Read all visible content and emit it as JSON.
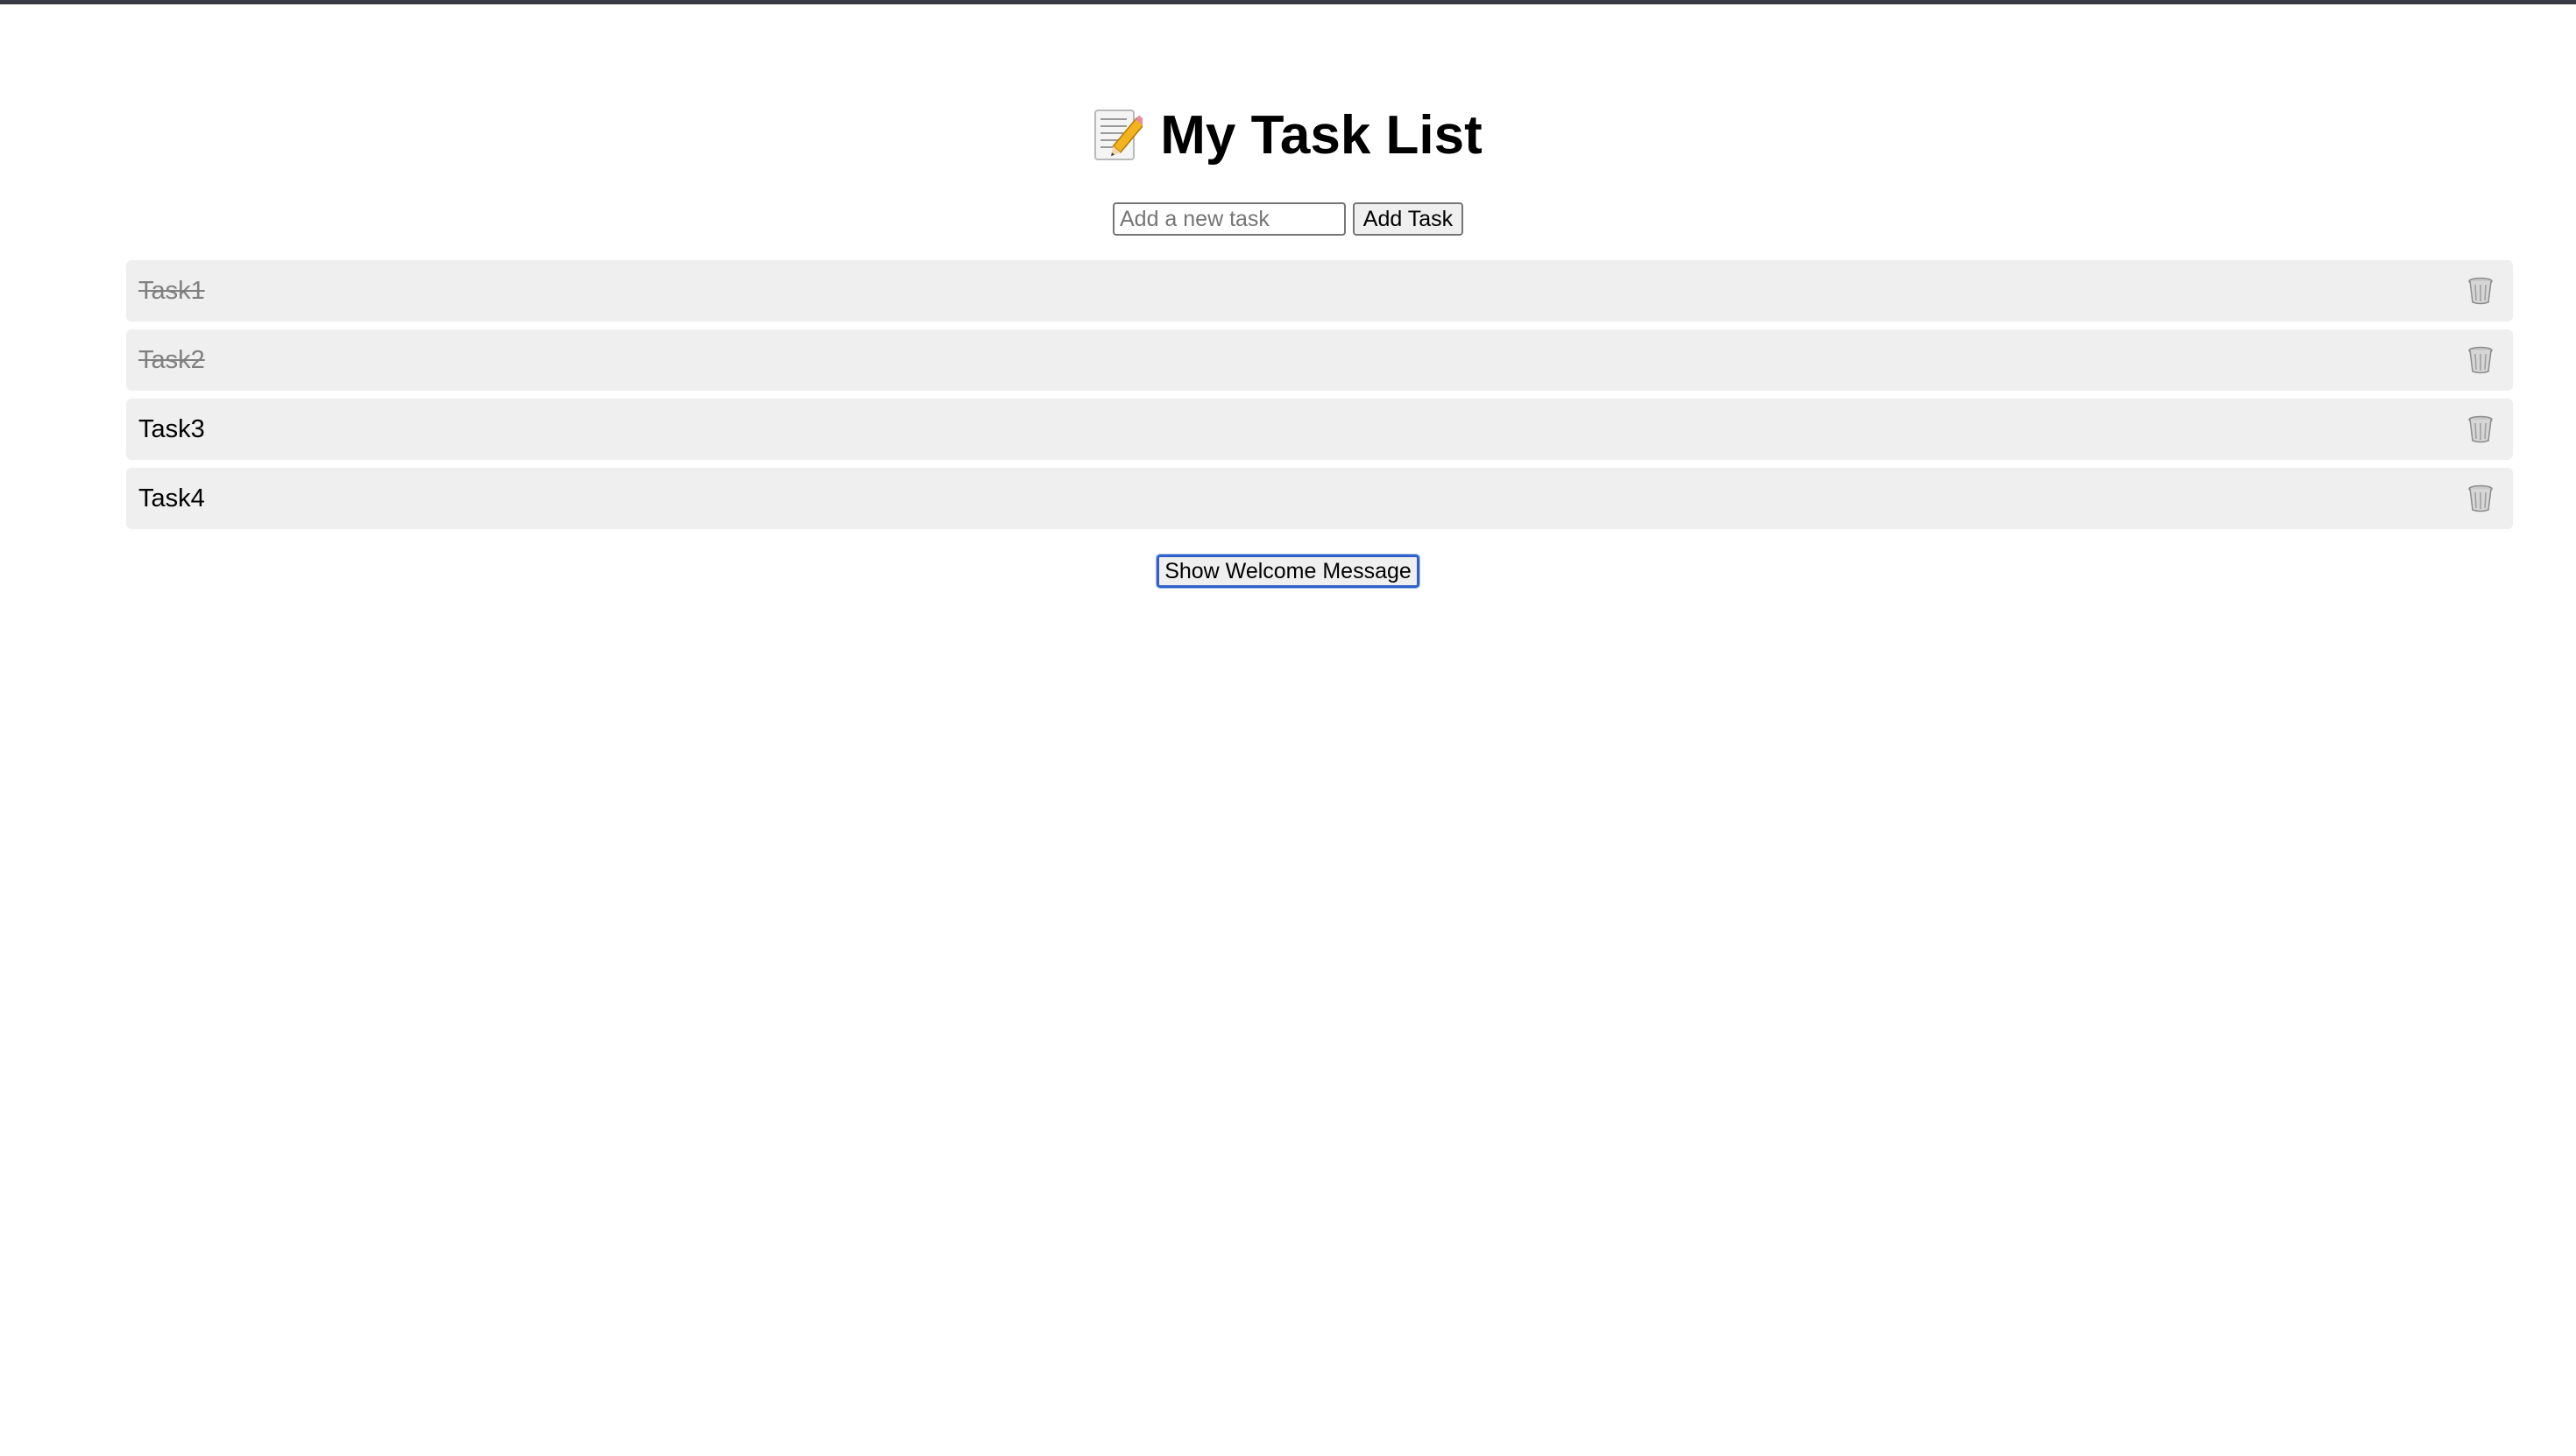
{
  "header": {
    "icon": "memo-pencil-icon",
    "title": "My Task List"
  },
  "add_form": {
    "placeholder": "Add a new task",
    "value": "",
    "button_label": "Add Task"
  },
  "tasks": [
    {
      "label": "Task1",
      "completed": true,
      "delete_icon": "wastebasket-icon"
    },
    {
      "label": "Task2",
      "completed": true,
      "delete_icon": "wastebasket-icon"
    },
    {
      "label": "Task3",
      "completed": false,
      "delete_icon": "wastebasket-icon"
    },
    {
      "label": "Task4",
      "completed": false,
      "delete_icon": "wastebasket-icon"
    }
  ],
  "welcome_button": {
    "label": "Show Welcome Message"
  },
  "colors": {
    "top_bar": "#3a3a46",
    "task_background": "#efefef",
    "completed_text": "#808080",
    "focus_ring": "#2f62c9"
  }
}
